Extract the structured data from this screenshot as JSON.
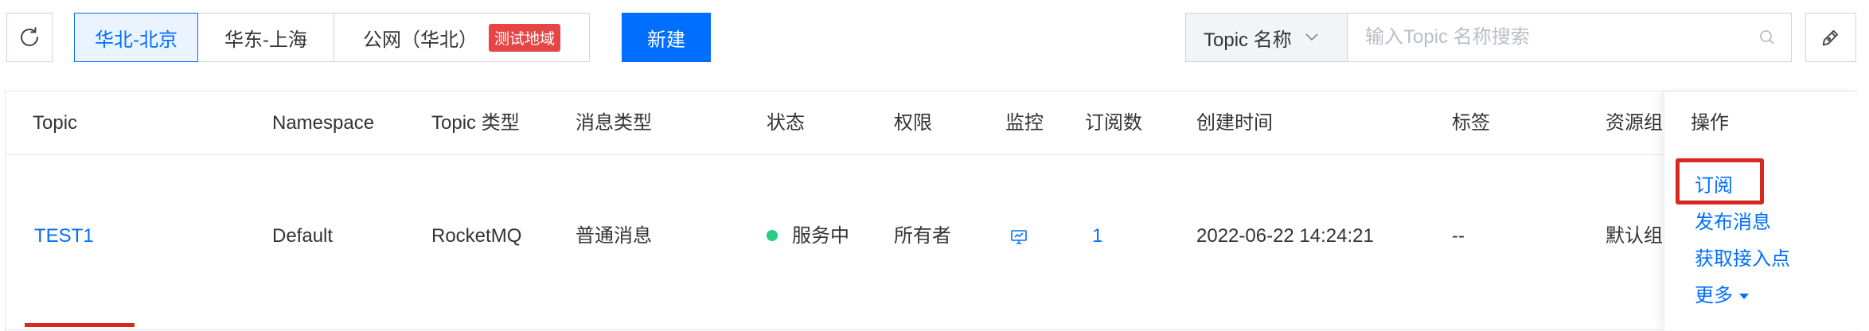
{
  "toolbar": {
    "regions": [
      {
        "label": "华北-北京",
        "active": true
      },
      {
        "label": "华东-上海",
        "active": false
      },
      {
        "label": "公网（华北）",
        "active": false,
        "badge": "测试地域"
      }
    ],
    "create_label": "新建",
    "search": {
      "filter_label": "Topic 名称",
      "placeholder": "输入Topic 名称搜索"
    },
    "icons": [
      "refresh-icon",
      "chevron-down-icon",
      "search-icon",
      "edit-icon"
    ]
  },
  "table": {
    "columns": {
      "topic": "Topic",
      "namespace": "Namespace",
      "topic_type": "Topic 类型",
      "msg_type": "消息类型",
      "status": "状态",
      "permission": "权限",
      "monitor": "监控",
      "subscriptions": "订阅数",
      "created": "创建时间",
      "tags": "标签",
      "resource_group": "资源组",
      "actions": "操作"
    },
    "rows": [
      {
        "topic": "TEST1",
        "namespace": "Default",
        "topic_type": "RocketMQ",
        "msg_type": "普通消息",
        "status": "服务中",
        "permission": "所有者",
        "monitor_icon": "monitor-icon",
        "subscriptions": "1",
        "created": "2022-06-22 14:24:21",
        "tags": "--",
        "resource_group": "默认组",
        "actions": {
          "subscribe": "订阅",
          "publish": "发布消息",
          "access_point": "获取接入点",
          "more": "更多"
        }
      }
    ]
  },
  "colors": {
    "primary": "#006eff",
    "annotation_red": "#d9281f",
    "status_green": "#29cc85",
    "badge_red": "#e54545"
  }
}
